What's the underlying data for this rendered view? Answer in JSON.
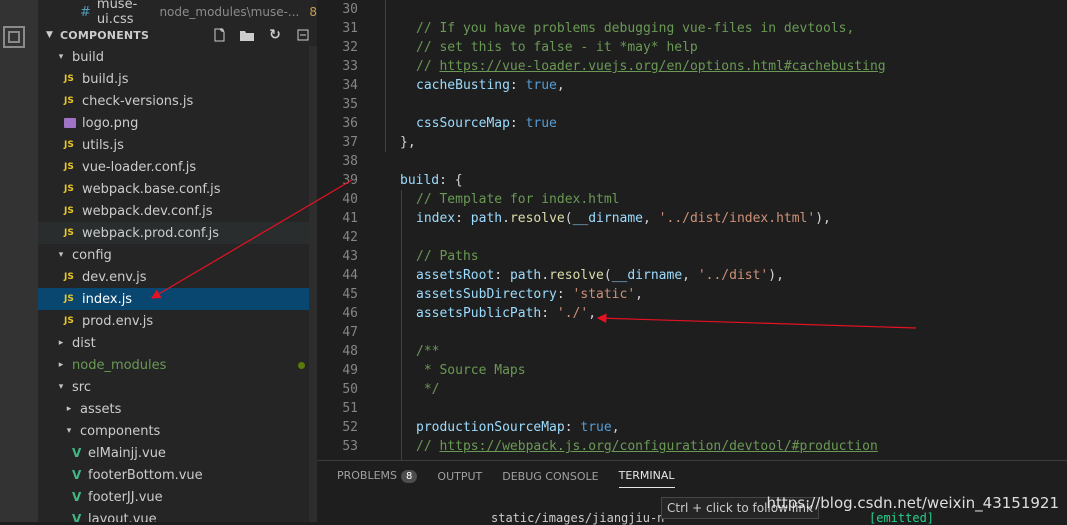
{
  "open_editor": {
    "name": "muse-ui.css",
    "path": "node_modules\\muse-...",
    "count": "8"
  },
  "sidebar": {
    "section_title": "COMPONENTS",
    "items": [
      {
        "label": "build",
        "kind": "folder",
        "indent": 1,
        "open": true
      },
      {
        "label": "build.js",
        "kind": "js",
        "indent": 2
      },
      {
        "label": "check-versions.js",
        "kind": "js",
        "indent": 2
      },
      {
        "label": "logo.png",
        "kind": "img",
        "indent": 2
      },
      {
        "label": "utils.js",
        "kind": "js",
        "indent": 2
      },
      {
        "label": "vue-loader.conf.js",
        "kind": "js",
        "indent": 2
      },
      {
        "label": "webpack.base.conf.js",
        "kind": "js",
        "indent": 2
      },
      {
        "label": "webpack.dev.conf.js",
        "kind": "js",
        "indent": 2
      },
      {
        "label": "webpack.prod.conf.js",
        "kind": "js",
        "indent": 2
      },
      {
        "label": "config",
        "kind": "folder",
        "indent": 1,
        "open": true
      },
      {
        "label": "dev.env.js",
        "kind": "js",
        "indent": 2
      },
      {
        "label": "index.js",
        "kind": "js",
        "indent": 2,
        "selected": true
      },
      {
        "label": "prod.env.js",
        "kind": "js",
        "indent": 2
      },
      {
        "label": "dist",
        "kind": "folder",
        "indent": 1,
        "open": false
      },
      {
        "label": "node_modules",
        "kind": "folder",
        "indent": 1,
        "open": false,
        "green": true
      },
      {
        "label": "src",
        "kind": "folder",
        "indent": 1,
        "open": true
      },
      {
        "label": "assets",
        "kind": "folder",
        "indent": 2,
        "open": false
      },
      {
        "label": "components",
        "kind": "folder",
        "indent": 2,
        "open": true
      },
      {
        "label": "elMainjj.vue",
        "kind": "vue",
        "indent": 3
      },
      {
        "label": "footerBottom.vue",
        "kind": "vue",
        "indent": 3
      },
      {
        "label": "footerJJ.vue",
        "kind": "vue",
        "indent": 3
      },
      {
        "label": "layout.vue",
        "kind": "vue",
        "indent": 3
      }
    ]
  },
  "editor": {
    "lines": [
      {
        "n": "30",
        "indent": 2,
        "parts": []
      },
      {
        "n": "31",
        "indent": 2,
        "parts": [
          [
            "cm",
            "// If you have problems debugging vue-files in devtools,"
          ]
        ]
      },
      {
        "n": "32",
        "indent": 2,
        "parts": [
          [
            "cm",
            "// set this to false - it *may* help"
          ]
        ]
      },
      {
        "n": "33",
        "indent": 2,
        "parts": [
          [
            "cm",
            "// "
          ],
          [
            "link",
            "https://vue-loader.vuejs.org/en/options.html#cachebusting"
          ]
        ]
      },
      {
        "n": "34",
        "indent": 2,
        "parts": [
          [
            "code",
            "cacheBusting"
          ],
          [
            "pl",
            ": "
          ],
          [
            "kw",
            "true"
          ],
          [
            "pl",
            ","
          ]
        ]
      },
      {
        "n": "35",
        "indent": 2,
        "parts": []
      },
      {
        "n": "36",
        "indent": 2,
        "parts": [
          [
            "code",
            "cssSourceMap"
          ],
          [
            "pl",
            ": "
          ],
          [
            "kw",
            "true"
          ]
        ]
      },
      {
        "n": "37",
        "indent": 1,
        "parts": [
          [
            "pl",
            "},"
          ]
        ]
      },
      {
        "n": "38",
        "indent": 1,
        "parts": []
      },
      {
        "n": "39",
        "indent": 1,
        "parts": [
          [
            "code",
            "build"
          ],
          [
            "pl",
            ": {"
          ]
        ]
      },
      {
        "n": "40",
        "indent": 2,
        "parts": [
          [
            "cm",
            "// Template for index.html"
          ]
        ]
      },
      {
        "n": "41",
        "indent": 2,
        "parts": [
          [
            "code",
            "index"
          ],
          [
            "pl",
            ": "
          ],
          [
            "code",
            "path"
          ],
          [
            "pl",
            "."
          ],
          [
            "fn",
            "resolve"
          ],
          [
            "pl",
            "("
          ],
          [
            "code",
            "__dirname"
          ],
          [
            "pl",
            ", "
          ],
          [
            "str",
            "'../dist/index.html'"
          ],
          [
            "pl",
            "),"
          ]
        ]
      },
      {
        "n": "42",
        "indent": 2,
        "parts": []
      },
      {
        "n": "43",
        "indent": 2,
        "parts": [
          [
            "cm",
            "// Paths"
          ]
        ]
      },
      {
        "n": "44",
        "indent": 2,
        "parts": [
          [
            "code",
            "assetsRoot"
          ],
          [
            "pl",
            ": "
          ],
          [
            "code",
            "path"
          ],
          [
            "pl",
            "."
          ],
          [
            "fn",
            "resolve"
          ],
          [
            "pl",
            "("
          ],
          [
            "code",
            "__dirname"
          ],
          [
            "pl",
            ", "
          ],
          [
            "str",
            "'../dist'"
          ],
          [
            "pl",
            "),"
          ]
        ]
      },
      {
        "n": "45",
        "indent": 2,
        "parts": [
          [
            "code",
            "assetsSubDirectory"
          ],
          [
            "pl",
            ": "
          ],
          [
            "str",
            "'static'"
          ],
          [
            "pl",
            ","
          ]
        ]
      },
      {
        "n": "46",
        "indent": 2,
        "parts": [
          [
            "code",
            "assetsPublicPath"
          ],
          [
            "pl",
            ": "
          ],
          [
            "str",
            "'./'"
          ],
          [
            "pl",
            ","
          ]
        ]
      },
      {
        "n": "47",
        "indent": 2,
        "parts": []
      },
      {
        "n": "48",
        "indent": 2,
        "parts": [
          [
            "cm",
            "/**"
          ]
        ]
      },
      {
        "n": "49",
        "indent": 2,
        "parts": [
          [
            "cm",
            " * Source Maps"
          ]
        ]
      },
      {
        "n": "50",
        "indent": 2,
        "parts": [
          [
            "cm",
            " */"
          ]
        ]
      },
      {
        "n": "51",
        "indent": 2,
        "parts": []
      },
      {
        "n": "52",
        "indent": 2,
        "parts": [
          [
            "code",
            "productionSourceMap"
          ],
          [
            "pl",
            ": "
          ],
          [
            "kw",
            "true"
          ],
          [
            "pl",
            ","
          ]
        ]
      },
      {
        "n": "53",
        "indent": 2,
        "parts": [
          [
            "cm",
            "// "
          ],
          [
            "link",
            "https://webpack.js.org/configuration/devtool/#production"
          ]
        ]
      }
    ]
  },
  "panel": {
    "tabs": [
      "PROBLEMS",
      "OUTPUT",
      "DEBUG CONSOLE",
      "TERMINAL"
    ],
    "problems_count": "8",
    "active_tab": "TERMINAL",
    "tooltip": "Ctrl + click to follow link",
    "terminal_text": "static/images/jiangjiu-n",
    "terminal_status": "[emitted]"
  },
  "watermark": "https://blog.csdn.net/weixin_43151921",
  "colors": {
    "selection": "#094771",
    "annotation_arrow": "#e81123"
  }
}
